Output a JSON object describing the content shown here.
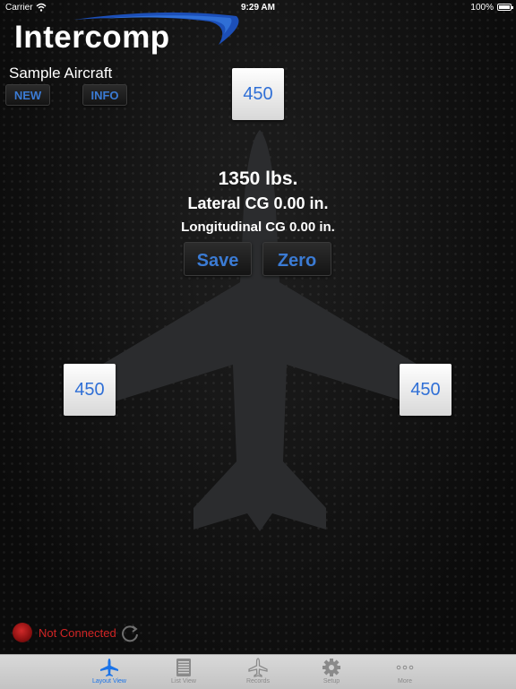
{
  "status_bar": {
    "carrier": "Carrier",
    "time": "9:29 AM",
    "battery": "100%"
  },
  "logo": {
    "text": "Intercomp"
  },
  "aircraft": {
    "name": "Sample Aircraft"
  },
  "buttons": {
    "new": "NEW",
    "info": "INFO",
    "save": "Save",
    "zero": "Zero"
  },
  "scales": {
    "nose": "450",
    "left": "450",
    "right": "450"
  },
  "readout": {
    "total_weight": "1350 lbs.",
    "lateral_cg": "Lateral CG 0.00 in.",
    "longitudinal_cg": "Longitudinal CG 0.00 in."
  },
  "connection": {
    "status": "Not Connected",
    "status_color": "#d02424"
  },
  "tabs": [
    {
      "label": "Layout View",
      "icon": "airplane-icon",
      "active": true
    },
    {
      "label": "List View",
      "icon": "list-icon",
      "active": false
    },
    {
      "label": "Records",
      "icon": "records-airplane-icon",
      "active": false
    },
    {
      "label": "Setup",
      "icon": "gear-icon",
      "active": false
    },
    {
      "label": "More",
      "icon": "more-icon",
      "active": false
    }
  ],
  "colors": {
    "accent": "#3b7bd4",
    "tab_active": "#1a73e8",
    "error": "#d02424"
  }
}
